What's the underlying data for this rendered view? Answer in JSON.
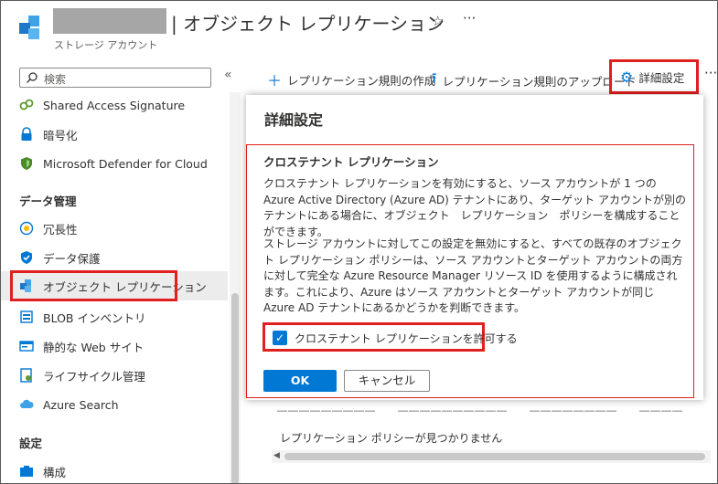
{
  "header": {
    "title": "| オブジェクト レプリケーション",
    "subtitle": "ストレージ アカウント",
    "favorite_icon": "star-icon",
    "more_icon": "ellipsis-icon"
  },
  "sidebar": {
    "search_placeholder": "検索",
    "collapse_label": "«",
    "items_top": [
      {
        "label": "Shared Access Signature",
        "icon": "key-icon"
      },
      {
        "label": "暗号化",
        "icon": "lock-icon"
      },
      {
        "label": "Microsoft Defender for Cloud",
        "icon": "shield-icon"
      }
    ],
    "section_data_management": "データ管理",
    "items_data": [
      {
        "label": "冗長性",
        "icon": "globe-icon"
      },
      {
        "label": "データ保護",
        "icon": "shield-check-icon"
      },
      {
        "label": "オブジェクト レプリケーション",
        "icon": "replication-icon"
      },
      {
        "label": "BLOB インベントリ",
        "icon": "inventory-icon"
      },
      {
        "label": "静的な Web サイト",
        "icon": "website-icon"
      },
      {
        "label": "ライフサイクル管理",
        "icon": "lifecycle-icon"
      },
      {
        "label": "Azure Search",
        "icon": "cloud-search-icon"
      }
    ],
    "section_settings": "設定",
    "items_settings": [
      {
        "label": "構成",
        "icon": "config-icon"
      }
    ]
  },
  "toolbar": {
    "create_rule": "レプリケーション規則の作成",
    "upload_rule": "レプリケーション規則のアップロード",
    "advanced_settings": "詳細設定",
    "more": "···"
  },
  "panel": {
    "title": "詳細設定",
    "section_title": "クロステナント レプリケーション",
    "para1": "クロステナント レプリケーションを有効にすると、ソース アカウントが 1 つの Azure Active Directory (Azure AD) テナントにあり、ターゲット アカウントが別のテナントにある場合に、オブジェクト　レプリケーション　ポリシーを構成することができます。",
    "para2": "ストレージ アカウントに対してこの設定を無効にすると、すべての既存のオブジェクト レプリケーション ポリシーは、ソース アカウントとターゲット アカウントの両方に対して完全な Azure Resource Manager リソース ID を使用するように構成されます。これにより、Azure はソース アカウントとターゲット アカウントが同じ Azure AD テナントにあるかどうかを判断できます。",
    "checkbox_label": "クロステナント レプリケーションを許可する",
    "checkbox_checked": true,
    "ok_label": "OK",
    "cancel_label": "キャンセル"
  },
  "content": {
    "empty_message": "レプリケーション ポリシーが見つかりません"
  },
  "colors": {
    "accent": "#0078d4",
    "highlight": "#e01f1f",
    "selected_bg": "#ececec"
  }
}
